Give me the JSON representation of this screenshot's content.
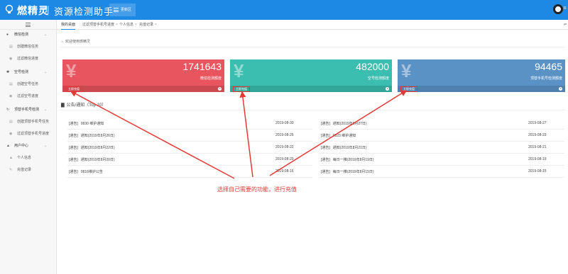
{
  "header": {
    "brand": "燃精灵",
    "separator": "|",
    "subtitle": "资源检测助手",
    "menu_toggle": "更新区",
    "user": "R"
  },
  "sidebar": {
    "items": [
      {
        "label": "微信检测",
        "icon": "wechat-icon",
        "group": true
      },
      {
        "label": "创建微信任务",
        "icon": "doc-icon",
        "group": false
      },
      {
        "label": "过滤微信进度",
        "icon": "eye-icon",
        "group": false
      },
      {
        "label": "空号检测",
        "icon": "gear-icon",
        "group": true
      },
      {
        "label": "创建空号任务",
        "icon": "doc-icon",
        "group": false
      },
      {
        "label": "过滤空号进度",
        "icon": "eye-icon",
        "group": false
      },
      {
        "label": "顶替手机号检测",
        "icon": "refresh-icon",
        "group": true
      },
      {
        "label": "创建顶替手机号任务",
        "icon": "doc-icon",
        "group": false
      },
      {
        "label": "过滤顶替手机号进度",
        "icon": "eye-icon",
        "group": false
      },
      {
        "label": "用户中心",
        "icon": "users-icon",
        "group": true
      },
      {
        "label": "个人信息",
        "icon": "user-icon",
        "group": false
      },
      {
        "label": "充值记录",
        "icon": "edit-icon",
        "group": false
      }
    ]
  },
  "tabs": [
    {
      "label": "我的桌面",
      "active": true
    },
    {
      "label": "过滤顶替手机号进度",
      "active": false
    },
    {
      "label": "个人信息",
      "active": false
    },
    {
      "label": "充值记录",
      "active": false
    }
  ],
  "tab_close": "×",
  "welcome": "欢迎使用燃精灵",
  "cards": [
    {
      "value": "1741643",
      "desc": "微信检测额度",
      "button": "立即充值",
      "color": "#e8555e",
      "symbol": "¥"
    },
    {
      "value": "482000",
      "desc": "空号检测额度",
      "button": "立即充值",
      "color": "#3bbdb0",
      "symbol": "¥"
    },
    {
      "value": "94465",
      "desc": "顶替手机号检测额度",
      "button": "立即充值",
      "color": "#5b92c6",
      "symbol": "¥"
    }
  ],
  "notices": {
    "title": "公告/通知（Top 10）",
    "left": [
      {
        "tag": "[通告]",
        "text": "0830 维护通知",
        "date": "2019-08-30"
      },
      {
        "tag": "[通告]",
        "text": "通知(2019年8月26日)",
        "date": "2019-08-26"
      },
      {
        "tag": "[通告]",
        "text": "通知(2019年8月22日)",
        "date": "2019-08-22"
      },
      {
        "tag": "[通告]",
        "text": "通知(2019年8月20日)",
        "date": "2019-08-20"
      },
      {
        "tag": "[通告]",
        "text": "0816维护公告",
        "date": "2019-08-16"
      }
    ],
    "right": [
      {
        "tag": "[通告]",
        "text": "通知(2019年8月27日)",
        "date": "2019-08-27"
      },
      {
        "tag": "[通告]",
        "text": "0823 维护通知",
        "date": "2019-08-23"
      },
      {
        "tag": "[通告]",
        "text": "通知(2019年8月21日)",
        "date": "2019-08-21"
      },
      {
        "tag": "[通告]",
        "text": "每日一推(2019年8月19日)",
        "date": "2019-08-19"
      },
      {
        "tag": "[通告]",
        "text": "每日一推(2019年8月15日)",
        "date": "2019-08-15"
      }
    ]
  },
  "annotation": {
    "caption": "选择自己需要的功能，进行充值",
    "color": "#e53935"
  }
}
